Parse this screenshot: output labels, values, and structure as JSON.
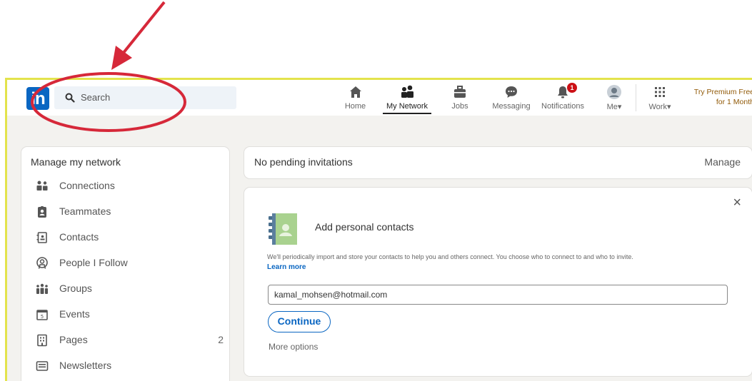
{
  "app": {
    "logo_text": "in",
    "brand_color": "#0a66c2"
  },
  "search": {
    "placeholder": "Search"
  },
  "nav": {
    "items": [
      {
        "label": "Home",
        "icon": "home-icon"
      },
      {
        "label": "My Network",
        "icon": "network-icon",
        "active": true
      },
      {
        "label": "Jobs",
        "icon": "briefcase-icon"
      },
      {
        "label": "Messaging",
        "icon": "message-icon"
      },
      {
        "label": "Notifications",
        "icon": "bell-icon",
        "badge": "1"
      },
      {
        "label": "Me",
        "icon": "avatar-icon"
      },
      {
        "label": "Work",
        "icon": "grid-icon"
      }
    ],
    "premium_line1": "Try Premium Free",
    "premium_line2": "for 1 Month"
  },
  "sidebar": {
    "title": "Manage my network",
    "items": [
      {
        "label": "Connections",
        "icon": "people-icon"
      },
      {
        "label": "Teammates",
        "icon": "badge-icon"
      },
      {
        "label": "Contacts",
        "icon": "contact-book-icon"
      },
      {
        "label": "People I Follow",
        "icon": "follow-icon"
      },
      {
        "label": "Groups",
        "icon": "groups-icon"
      },
      {
        "label": "Events",
        "icon": "calendar-icon"
      },
      {
        "label": "Pages",
        "icon": "building-icon",
        "count": "2"
      },
      {
        "label": "Newsletters",
        "icon": "newsletter-icon"
      }
    ]
  },
  "invitations": {
    "text": "No pending invitations",
    "manage_label": "Manage"
  },
  "contacts": {
    "title": "Add personal contacts",
    "description": "We'll periodically import and store your contacts to help you and others connect. You choose who to connect to and who to invite.",
    "learn_more": "Learn more",
    "email_value": "kamal_mohsen@hotmail.com",
    "continue_label": "Continue",
    "more_options": "More options",
    "close_symbol": "×"
  },
  "annotation": {
    "color": "#d62839",
    "shapes": [
      "arrow",
      "ellipse"
    ]
  }
}
